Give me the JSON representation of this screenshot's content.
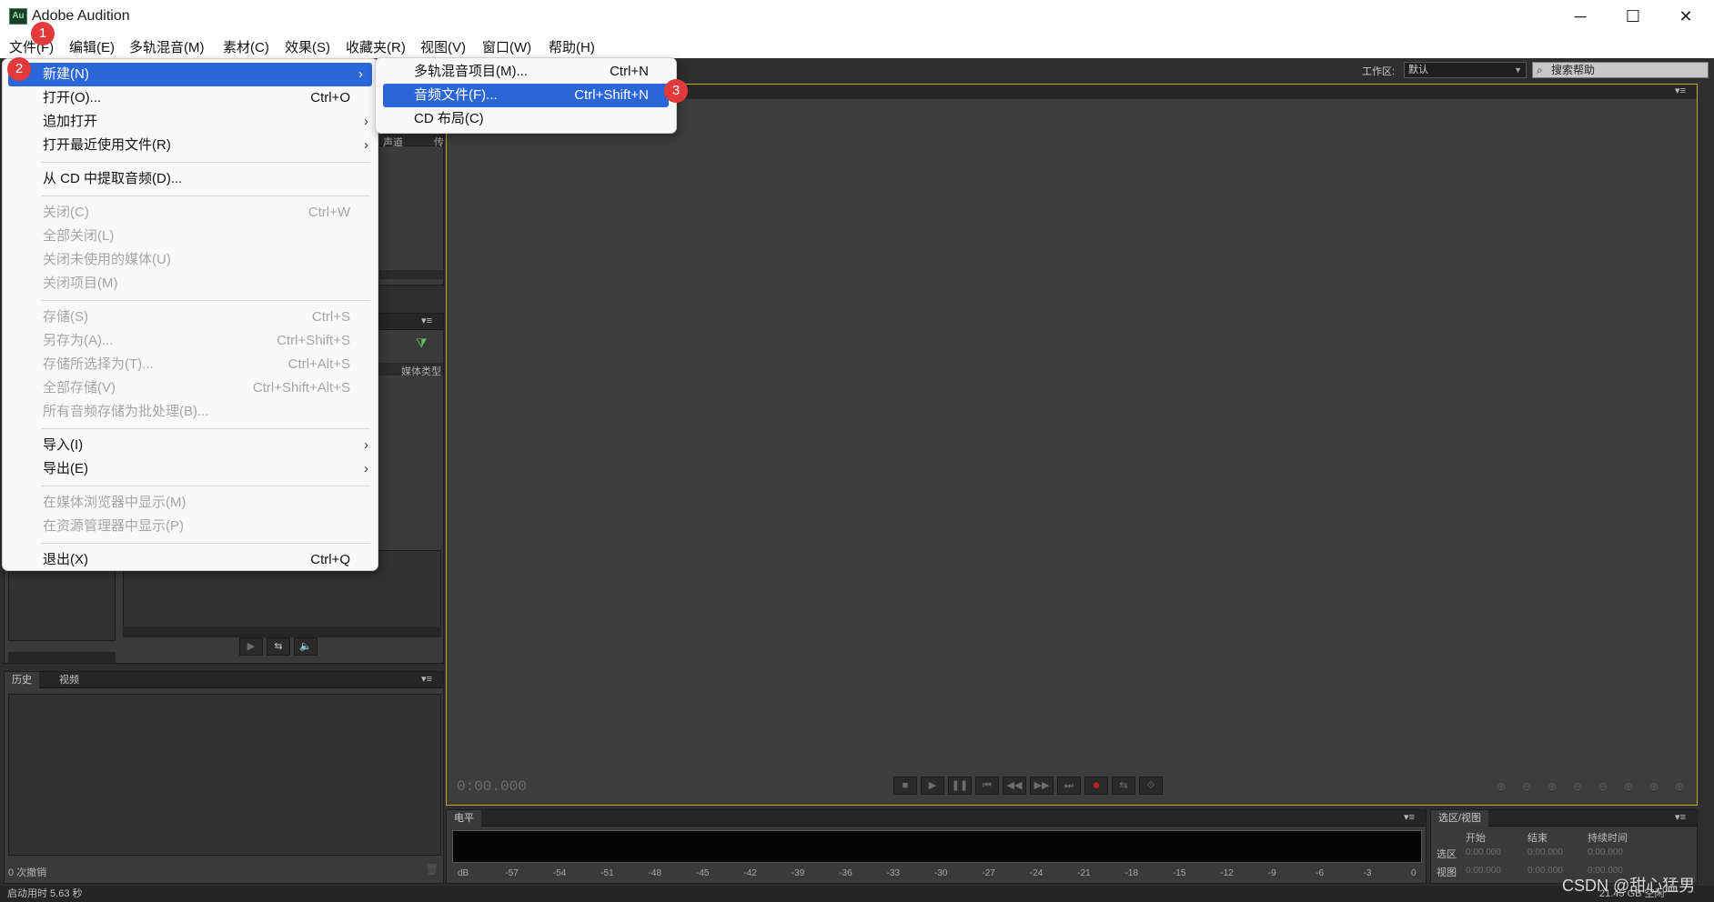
{
  "window": {
    "app_icon": "Au",
    "title": "Adobe Audition",
    "minimize_icon": "─",
    "maximize_icon": "☐",
    "close_icon": "✕"
  },
  "menubar": {
    "items": [
      "文件(F)",
      "编辑(E)",
      "多轨混音(M)",
      "素材(C)",
      "效果(S)",
      "收藏夹(R)",
      "视图(V)",
      "窗口(W)",
      "帮助(H)"
    ]
  },
  "toolbar": {
    "workspace_label": "工作区:",
    "workspace_value": "默认",
    "search_placeholder": "搜索帮助"
  },
  "file_menu": {
    "items": [
      {
        "label": "新建(N)",
        "shortcut": "",
        "submenu": true,
        "enabled": true,
        "highlighted": true
      },
      {
        "label": "打开(O)...",
        "shortcut": "Ctrl+O",
        "enabled": true
      },
      {
        "label": "追加打开",
        "shortcut": "",
        "submenu": true,
        "enabled": true
      },
      {
        "label": "打开最近使用文件(R)",
        "shortcut": "",
        "submenu": true,
        "enabled": true
      },
      {
        "label": "从 CD 中提取音频(D)...",
        "shortcut": "",
        "enabled": true
      },
      {
        "label": "关闭(C)",
        "shortcut": "Ctrl+W",
        "enabled": false
      },
      {
        "label": "全部关闭(L)",
        "shortcut": "",
        "enabled": false
      },
      {
        "label": "关闭未使用的媒体(U)",
        "shortcut": "",
        "enabled": false
      },
      {
        "label": "关闭项目(M)",
        "shortcut": "",
        "enabled": false
      },
      {
        "label": "存储(S)",
        "shortcut": "Ctrl+S",
        "enabled": false
      },
      {
        "label": "另存为(A)...",
        "shortcut": "Ctrl+Shift+S",
        "enabled": false
      },
      {
        "label": "存储所选择为(T)...",
        "shortcut": "Ctrl+Alt+S",
        "enabled": false
      },
      {
        "label": "全部存储(V)",
        "shortcut": "Ctrl+Shift+Alt+S",
        "enabled": false
      },
      {
        "label": "所有音频存储为批处理(B)...",
        "shortcut": "",
        "enabled": false
      },
      {
        "label": "导入(I)",
        "shortcut": "",
        "submenu": true,
        "enabled": true
      },
      {
        "label": "导出(E)",
        "shortcut": "",
        "submenu": true,
        "enabled": true
      },
      {
        "label": "在媒体浏览器中显示(M)",
        "shortcut": "",
        "enabled": false
      },
      {
        "label": "在资源管理器中显示(P)",
        "shortcut": "",
        "enabled": false
      },
      {
        "label": "退出(X)",
        "shortcut": "Ctrl+Q",
        "enabled": true
      }
    ]
  },
  "new_submenu": {
    "items": [
      {
        "label": "多轨混音项目(M)...",
        "shortcut": "Ctrl+N",
        "highlighted": false
      },
      {
        "label": "音频文件(F)...",
        "shortcut": "Ctrl+Shift+N",
        "highlighted": true
      },
      {
        "label": "CD 布局(C)",
        "shortcut": "",
        "highlighted": false
      }
    ]
  },
  "badges": [
    "1",
    "2",
    "3"
  ],
  "left_panel": {
    "column_media_type": "媒体类型",
    "column_channel": "声道",
    "column_extra": "传"
  },
  "history_panel": {
    "tabs": [
      "历史",
      "视频"
    ],
    "undo_count": "0 次撤销"
  },
  "editor": {
    "timecode": "0:00.000"
  },
  "transport": {
    "buttons": [
      "■",
      "▶",
      "❚❚",
      "⏮",
      "◀◀",
      "▶▶",
      "⏭",
      "●",
      "⇆",
      "⟐"
    ]
  },
  "meter": {
    "tab": "电平",
    "scale": [
      "dB",
      "-57",
      "-54",
      "-51",
      "-48",
      "-45",
      "-42",
      "-39",
      "-36",
      "-33",
      "-30",
      "-27",
      "-24",
      "-21",
      "-18",
      "-15",
      "-12",
      "-9",
      "-6",
      "-3",
      "0"
    ]
  },
  "selection_view": {
    "tab": "选区/视图",
    "col_start": "开始",
    "col_end": "结束",
    "col_duration": "持续时间",
    "row_selection": "选区",
    "row_view": "视图",
    "selection_start": "0:00.000",
    "selection_end": "0:00.000",
    "selection_duration": "0:00.000",
    "view_start": "0:00.000",
    "view_end": "0:00.000",
    "view_duration": "0:00.000"
  },
  "status": {
    "startup_time": "启动用时 5.63 秒",
    "free_space": "21.45 GB 空闲"
  },
  "watermark": "CSDN @甜心猛男"
}
